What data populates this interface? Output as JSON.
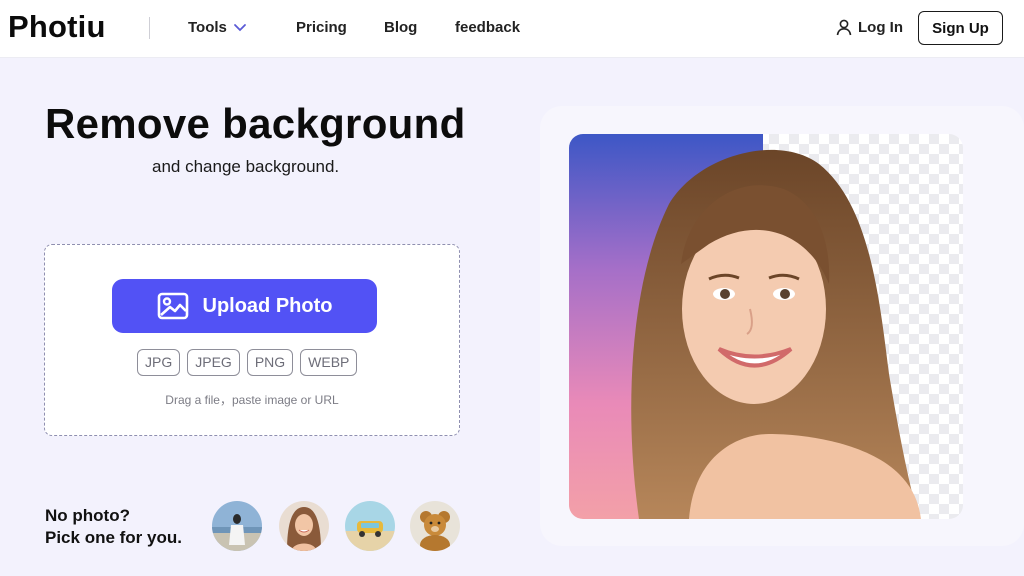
{
  "header": {
    "logo": "Photiu",
    "nav": {
      "tools": "Tools",
      "pricing": "Pricing",
      "blog": "Blog",
      "feedback": "feedback"
    },
    "login": "Log In",
    "signup": "Sign Up"
  },
  "hero": {
    "title": "Remove background",
    "subtitle": "and change background."
  },
  "upload": {
    "button_label": "Upload Photo",
    "formats": [
      "JPG",
      "JPEG",
      "PNG",
      "WEBP"
    ],
    "hint": "Drag a file，paste image or URL"
  },
  "samples": {
    "line1": "No photo?",
    "line2": "Pick one for you."
  },
  "colors": {
    "accent": "#5252f5",
    "page_bg": "#f3f2fd"
  },
  "icons": {
    "chevron": "chevron-down-icon",
    "user": "user-icon",
    "upload": "image-icon"
  }
}
